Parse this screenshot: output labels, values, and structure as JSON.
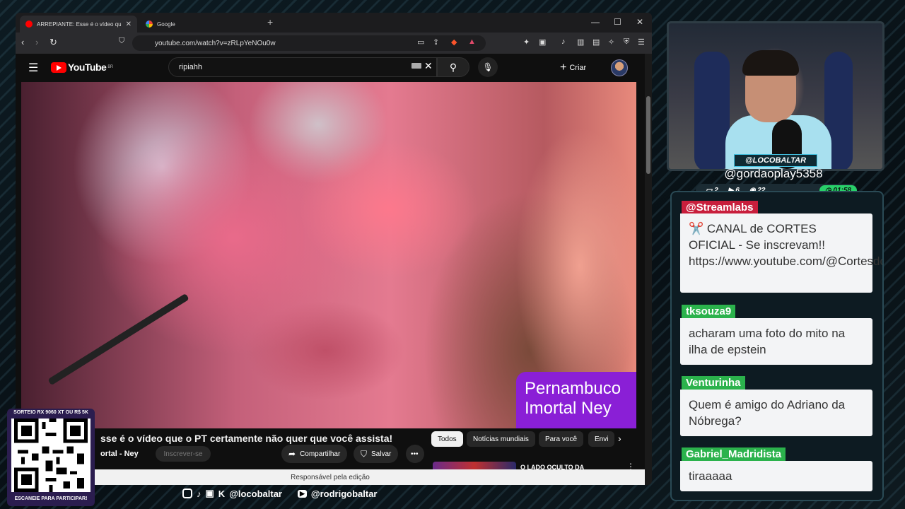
{
  "browser": {
    "tabs": [
      {
        "title": "ARREPIANTE: Esse é o vídeo que o",
        "active": true
      },
      {
        "title": "Google",
        "active": false
      }
    ],
    "url": "youtube.com/watch?v=zRLpYeNOu0w"
  },
  "youtube": {
    "logo_text": "YouTube",
    "region": "BR",
    "search_value": "ripiahh",
    "create_label": "Criar",
    "video_overlay": [
      "Pernambuco",
      "Imortal Ney"
    ],
    "video_title": "sse é o vídeo que o PT certamente não quer que você assista!",
    "channel_name": "ortal - Ney",
    "subscribe_label": "Inscrever-se",
    "share_label": "Compartilhar",
    "save_label": "Salvar",
    "chips": [
      "Todos",
      "Notícias mundiais",
      "Para você",
      "Envi"
    ],
    "related_title": "O LADO OCULTO DA",
    "footer_note": "Responsável pela edição"
  },
  "stream": {
    "handle_badge": "@LOCOBALTAR",
    "latest_follower": "@gordaoplay5358",
    "stats": {
      "a": "2",
      "b": "6",
      "c": "22",
      "time": "01:58"
    },
    "colors": {
      "accent": "#43c1e0",
      "green": "#29d06a",
      "purple": "#8a1fd6"
    }
  },
  "chat": [
    {
      "user": "@Streamlabs",
      "user_color": "#c81e3c",
      "text": "✂️ CANAL de CORTES OFICIAL - Se inscrevam!! https://www.youtube.com/@CortesdoBaltarOficial"
    },
    {
      "user": "tksouza9",
      "user_color": "#2bb24c",
      "text": "acharam uma foto do mito na ilha de epstein"
    },
    {
      "user": "Venturinha",
      "user_color": "#2bb24c",
      "text": "Quem é amigo do Adriano da Nóbrega?"
    },
    {
      "user": "Gabriel_Madridista",
      "user_color": "#2bb24c",
      "text": "tiraaaaa"
    }
  ],
  "social": {
    "handle1": "@locobaltar",
    "handle2": "@rodrigobaltar"
  },
  "qr": {
    "top": "SORTEIO RX 9060 XT OU R$ 5K",
    "bottom": "ESCANEIE PARA PARTICIPAR!"
  }
}
